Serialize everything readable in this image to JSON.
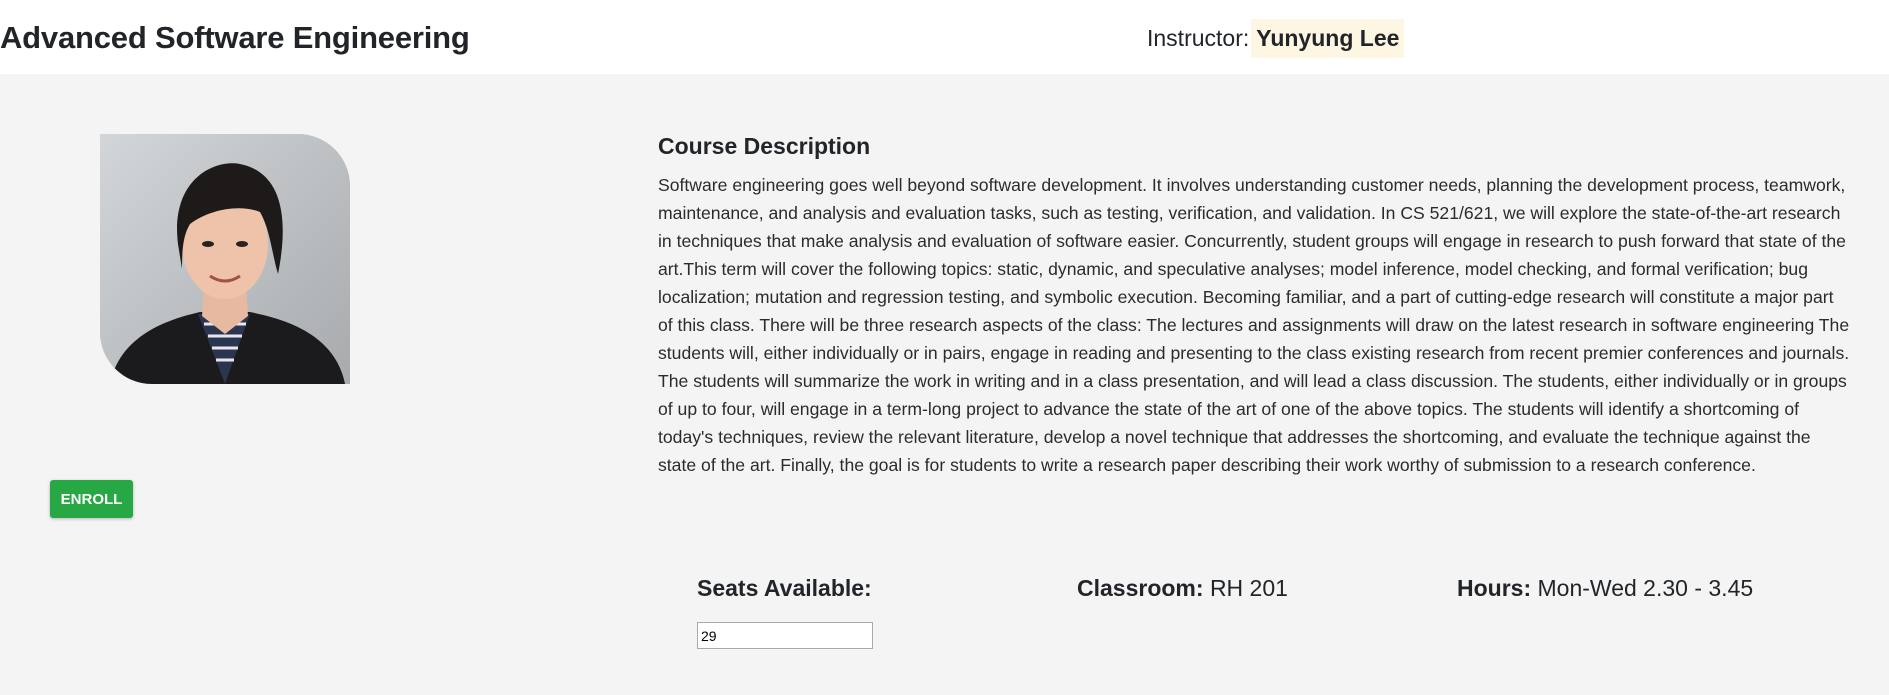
{
  "header": {
    "course_title": "Advanced Software Engineering",
    "instructor_label": "Instructor:",
    "instructor_name": "Yunyung Lee"
  },
  "enroll_button": {
    "label": "ENROLL"
  },
  "description": {
    "heading": "Course Description",
    "text": "Software engineering goes well beyond software development. It involves understanding customer needs, planning the development process, teamwork, maintenance, and analysis and evaluation tasks, such as testing, verification, and validation. In CS 521/621, we will explore the state-of-the-art research in techniques that make analysis and evaluation of software easier. Concurrently, student groups will engage in research to push forward that state of the art.This term will cover the following topics: static, dynamic, and speculative analyses; model inference, model checking, and formal verification; bug localization; mutation and regression testing, and symbolic execution. Becoming familiar, and a part of cutting-edge research will constitute a major part of this class. There will be three research aspects of the class: The lectures and assignments will draw on the latest research in software engineering The students will, either individually or in pairs, engage in reading and presenting to the class existing research from recent premier conferences and journals. The students will summarize the work in writing and in a class presentation, and will lead a class discussion. The students, either individually or in groups of up to four, will engage in a term-long project to advance the state of the art of one of the above topics. The students will identify a shortcoming of today's techniques, review the relevant literature, develop a novel technique that addresses the shortcoming, and evaluate the technique against the state of the art. Finally, the goal is for students to write a research paper describing their work worthy of submission to a research conference."
  },
  "details": {
    "seats_label": "Seats Available:",
    "seats_value": "29",
    "classroom_label": "Classroom:",
    "classroom_value": "RH 201",
    "hours_label": "Hours:",
    "hours_value": "Mon-Wed 2.30 - 3.45"
  },
  "colors": {
    "enroll_button": "#28a745",
    "instructor_highlight": "#fdf6e3",
    "page_background": "#f4f4f4"
  }
}
